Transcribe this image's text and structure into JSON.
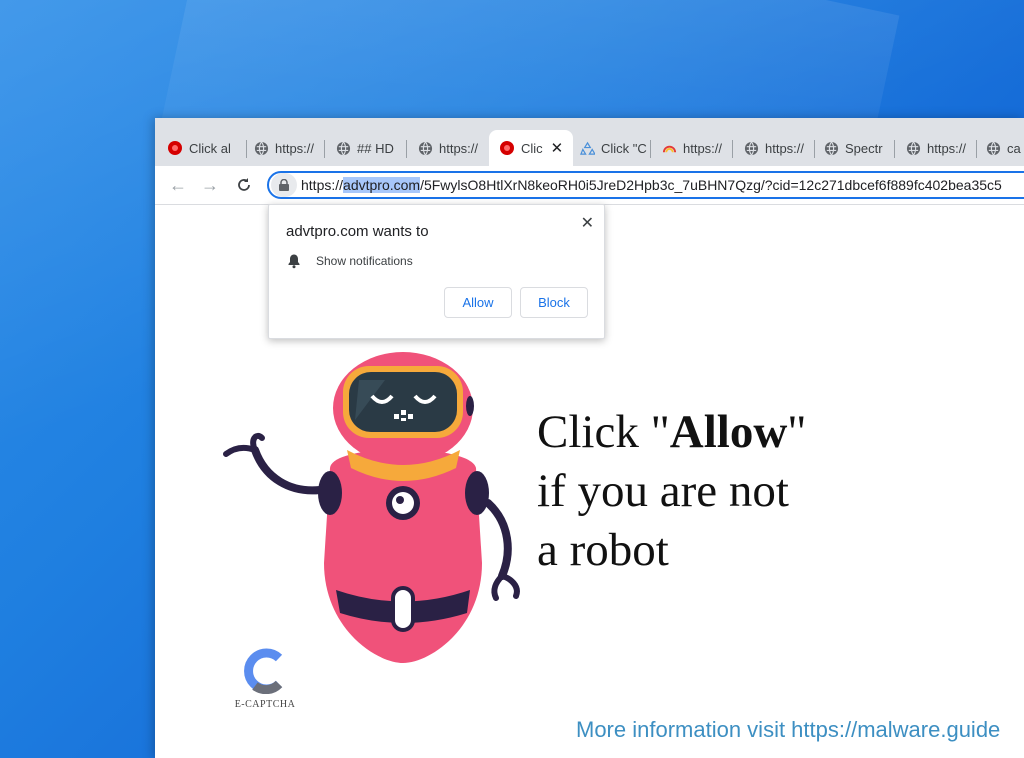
{
  "browser": {
    "tabs": [
      {
        "label": "Click al",
        "favicon": "red-circle-icon",
        "active": false
      },
      {
        "label": "https://",
        "favicon": "globe-icon",
        "active": false
      },
      {
        "label": "## HD",
        "favicon": "globe-icon",
        "active": false
      },
      {
        "label": "https://",
        "favicon": "globe-icon",
        "active": false
      },
      {
        "label": "Clic",
        "favicon": "red-circle-icon",
        "active": true
      },
      {
        "label": "Click \"C",
        "favicon": "recycle-icon",
        "active": false
      },
      {
        "label": "https://",
        "favicon": "rainbow-icon",
        "active": false
      },
      {
        "label": "https://",
        "favicon": "globe-icon",
        "active": false
      },
      {
        "label": "Spectr",
        "favicon": "globe-icon",
        "active": false
      },
      {
        "label": "https://",
        "favicon": "globe-icon",
        "active": false
      },
      {
        "label": "ca",
        "favicon": "globe-icon",
        "active": false
      }
    ],
    "url": {
      "scheme": "https://",
      "domain": "advtpro.com",
      "path": "/5FwylsO8HtlXrN8keoRH0i5JreD2Hpb3c_7uBHN7Qzg/?cid=12c271dbcef6f889fc402bea35c5"
    }
  },
  "popup": {
    "title": "advtpro.com wants to",
    "permission": "Show notifications",
    "allow_label": "Allow",
    "block_label": "Block"
  },
  "content": {
    "line1_pre": "Click \"",
    "line1_bold": "Allow",
    "line1_post": "\"",
    "line2": "if you are not",
    "line3": "a robot",
    "logo_text": "E-CAPTCHA"
  },
  "watermark": "More information visit https://malware.guide",
  "colors": {
    "robot_body": "#f0527a",
    "robot_dark": "#2a2145",
    "robot_collar": "#f6a93b",
    "accent_blue": "#1a73e8",
    "watermark": "#3d8fc2"
  }
}
